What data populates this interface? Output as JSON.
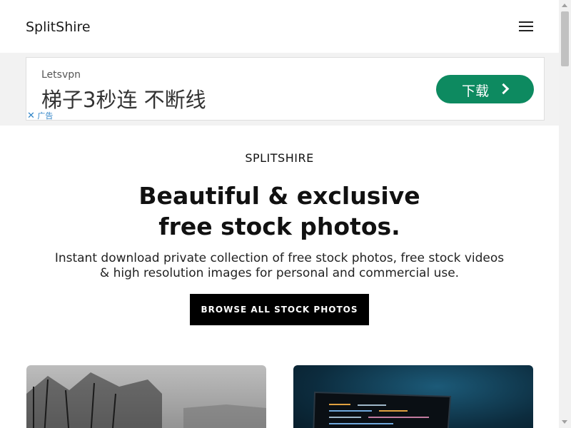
{
  "header": {
    "logo": "SplitShire",
    "menu_icon": "hamburger-menu-icon"
  },
  "ad": {
    "brand": "Letsvpn",
    "headline": "梯子3秒连 不断线",
    "button_label": "下载",
    "button_icon": "chevron-right-icon",
    "button_color": "#0d8a60",
    "choice_x": "✕",
    "choice_label": "广告"
  },
  "hero": {
    "eyebrow": "SPLITSHIRE",
    "title_line1": "Beautiful & exclusive",
    "title_line2": "free stock photos.",
    "desc_line1": "Instant download private collection of free stock photos, free stock videos",
    "desc_line2": "& high resolution images for personal and commercial use.",
    "cta": "BROWSE ALL STOCK PHOTOS"
  },
  "gallery": {
    "items": [
      {
        "type": "photo",
        "description": "black and white trees"
      },
      {
        "type": "photo",
        "description": "laptop with code on dark blue background"
      }
    ]
  }
}
